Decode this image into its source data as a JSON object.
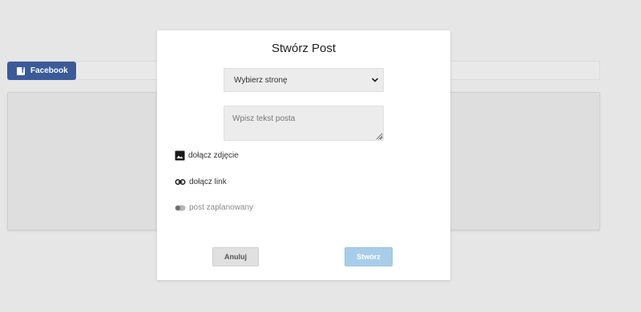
{
  "background": {
    "facebook_tab_label": "Facebook",
    "facebook_icon": "facebook-icon",
    "brand_color": "#3b5a99"
  },
  "modal": {
    "title": "Stwórz Post",
    "page_select": {
      "selected": "Wybierz stronę",
      "icon": "chevron-down-icon"
    },
    "post_text": {
      "value": "",
      "placeholder": "Wpisz tekst posta"
    },
    "options": {
      "photo_label": "dołącz zdjęcie",
      "photo_icon": "image-icon",
      "link_label": "dołącz link",
      "link_icon": "link-icon",
      "scheduled_label": "post zaplanowany",
      "scheduled_icon": "toggle-icon",
      "scheduled_on": false
    },
    "buttons": {
      "cancel_label": "Anuluj",
      "create_label": "Stwórz",
      "create_color": "#a8cdea"
    }
  }
}
